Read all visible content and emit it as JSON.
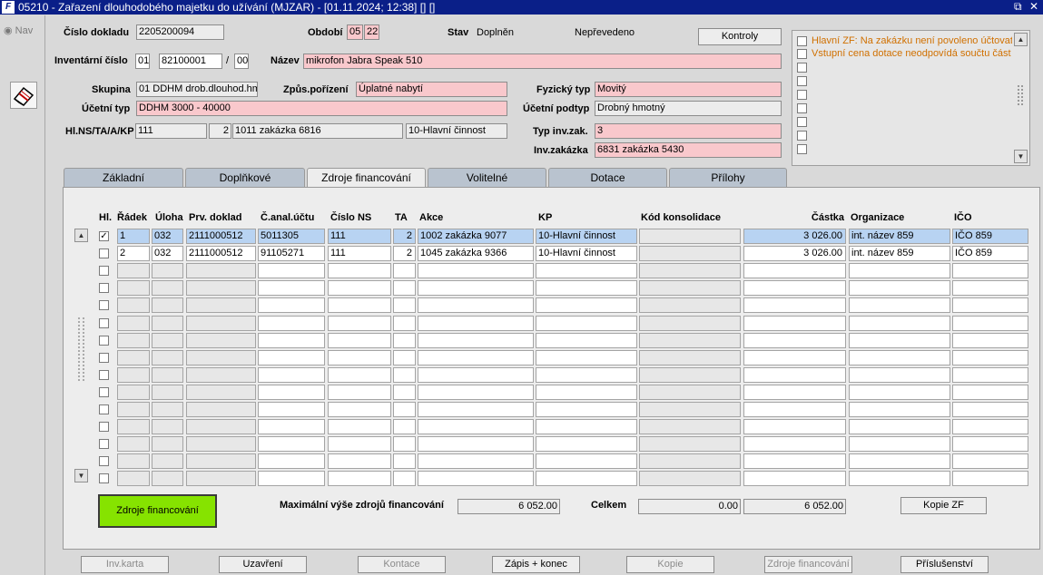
{
  "window": {
    "title": "05210 - Zařazení dlouhodobého majetku do užívání (MJZAR) - [01.11.2024; 12:38] [] []",
    "icon": "app-logo-icon",
    "restore_icon": "restore-window-icon",
    "close_icon": "close-icon"
  },
  "nav": {
    "label": "Nav",
    "erase_icon": "eraser-icon"
  },
  "header": {
    "cislo_dokladu_label": "Číslo dokladu",
    "cislo_dokladu": "2205200094",
    "obdobi_label": "Období",
    "obdobi_mm": "05",
    "obdobi_yy": "22",
    "stav_label": "Stav",
    "stav_value": "Doplněn",
    "stav_transfer": "Nepřevedeno",
    "kontroly_label": "Kontroly",
    "inv_cislo_label": "Inventární číslo",
    "inv_c1": "01",
    "inv_c2": "82100001",
    "inv_slash": "/",
    "inv_c3": "00",
    "nazev_label": "Název",
    "nazev": "mikrofon Jabra Speak 510",
    "skupina_label": "Skupina",
    "skupina": "01 DDHM drob.dlouhod.hm",
    "zpusob_label": "Způs.pořízení",
    "zpusob": "Úplatné nabytí",
    "fyz_typ_label": "Fyzický typ",
    "fyz_typ": "Movitý",
    "ucet_typ_label": "Účetní typ",
    "ucet_typ": "DDHM 3000 - 40000",
    "ucet_podtyp_label": "Účetní podtyp",
    "ucet_podtyp": "Drobný hmotný",
    "hlns_label": "Hl.NS/TA/A/KP",
    "hlns_ns": "111",
    "hlns_ta": "2",
    "hlns_a": "1011 zakázka 6816",
    "hlns_kp": "10-Hlavní činnost",
    "typ_inv_label": "Typ inv.zak.",
    "typ_inv": "3",
    "inv_zak_label": "Inv.zakázka",
    "inv_zak": "6831 zakázka 5430"
  },
  "messages": [
    {
      "text": "Hlavní ZF: Na zakázku není povoleno účtovat."
    },
    {
      "text": "Vstupní cena dotace neodpovídá součtu část"
    }
  ],
  "tabs": [
    "Základní",
    "Doplňkové",
    "Zdroje financování",
    "Volitelné",
    "Dotace",
    "Přílohy"
  ],
  "active_tab": "Zdroje financování",
  "table": {
    "headers": [
      "Hl.",
      "Řádek",
      "Úloha",
      "Prv. doklad",
      "Č.anal.účtu",
      "Číslo NS",
      "TA",
      "Akce",
      "KP",
      "Kód konsolidace",
      "Částka",
      "Organizace",
      "IČO"
    ],
    "rows": [
      {
        "hl": true,
        "radek": "1",
        "uloha": "032",
        "prv": "2111000512",
        "anal": "5011305",
        "ns": "111",
        "ta": "2",
        "akce": "1002 zakázka 9077",
        "kp": "10-Hlavní činnost",
        "kod": "",
        "castka": "3 026.00",
        "org": "int. název 859",
        "ico": "IČO 859"
      },
      {
        "hl": false,
        "radek": "2",
        "uloha": "032",
        "prv": "2111000512",
        "anal": "91105271",
        "ns": "111",
        "ta": "2",
        "akce": "1045 zakázka 9366",
        "kp": "10-Hlavní činnost",
        "kod": "",
        "castka": "3 026.00",
        "org": "int. název 859",
        "ico": "IČO 859"
      }
    ],
    "check_mark": "✓"
  },
  "footer": {
    "zf_button": "Zdroje financování",
    "max_label": "Maximální výše zdrojů financování",
    "max_value": "6 052.00",
    "celkem_label": "Celkem",
    "celkem_1": "0.00",
    "celkem_2": "6 052.00",
    "kopie_zf": "Kopie ZF"
  },
  "bottom_buttons": [
    {
      "label": "Inv.karta",
      "enabled": false
    },
    {
      "label": "Uzavření",
      "enabled": true
    },
    {
      "label": "Kontace",
      "enabled": false
    },
    {
      "label": "Zápis + konec",
      "enabled": true
    },
    {
      "label": "Kopie",
      "enabled": false
    },
    {
      "label": "Zdroje financování",
      "enabled": false
    },
    {
      "label": "Příslušenství",
      "enabled": true
    }
  ],
  "colors": {
    "title_bar": "#0a1f88",
    "required_field": "#f9c8cc",
    "selected_row": "#b8d3f2",
    "zf_button": "#86e300",
    "message": "#d07000",
    "tab": "#b9c3cf"
  }
}
